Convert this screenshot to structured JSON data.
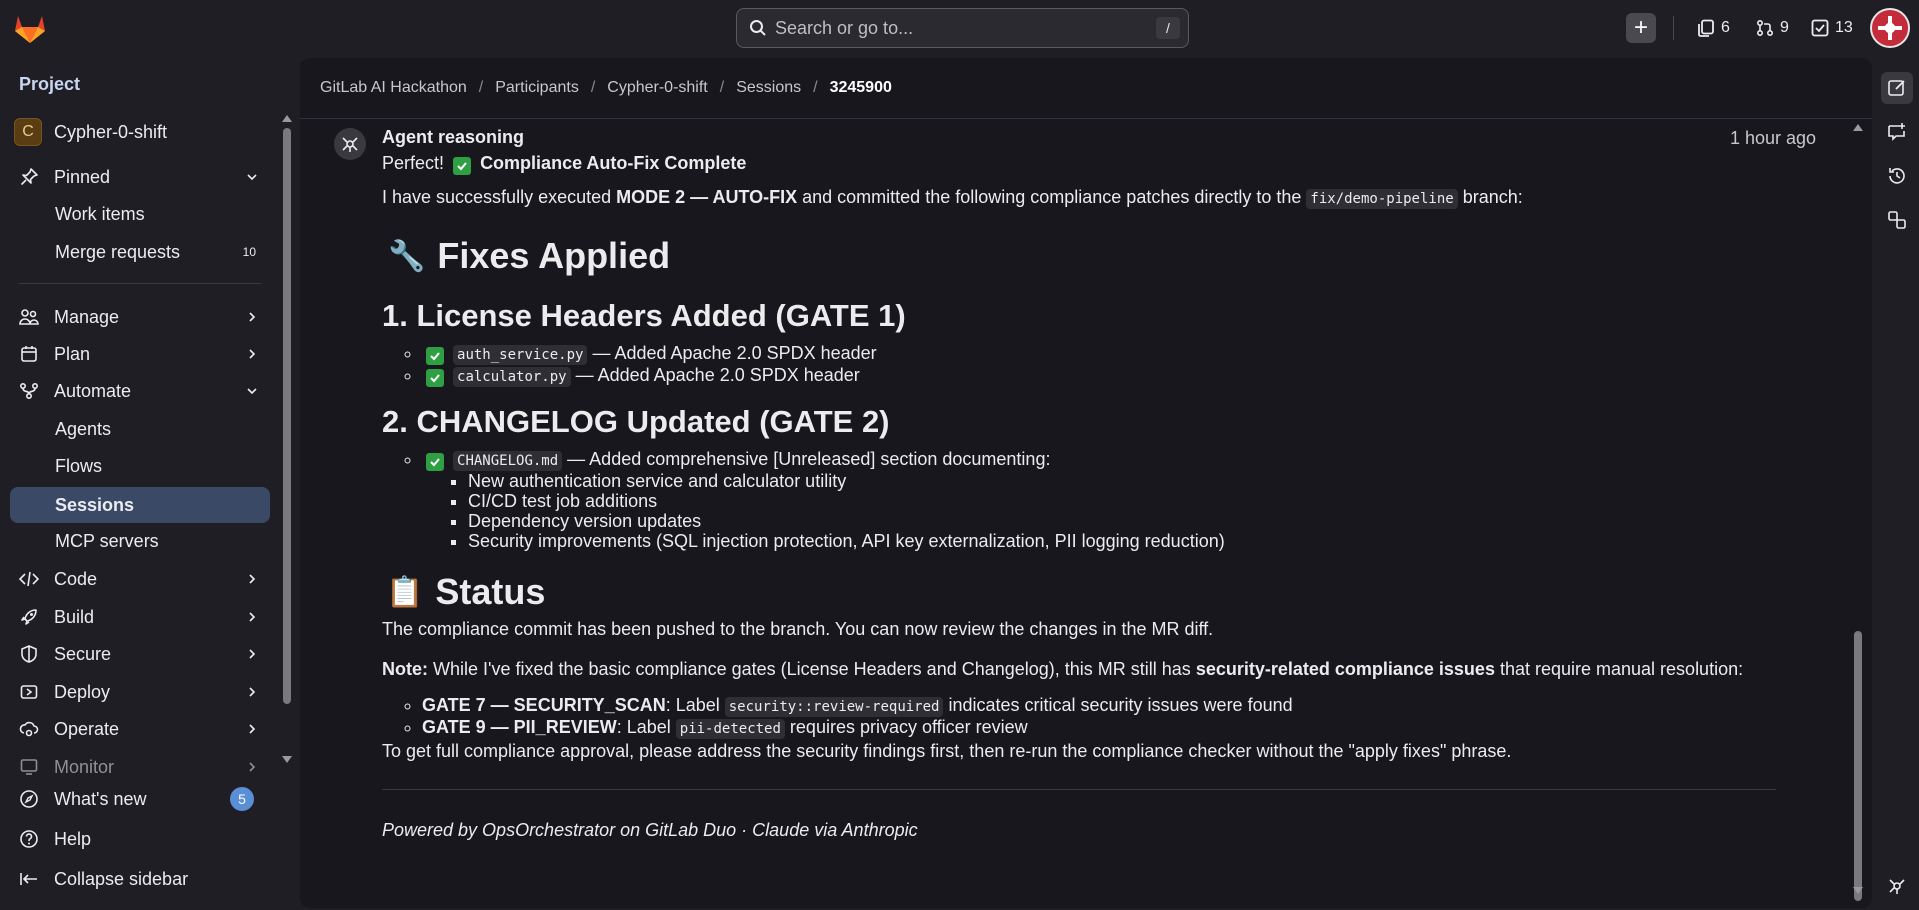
{
  "topbar": {
    "search_placeholder": "Search or go to...",
    "search_shortcut": "/",
    "issues_count": "6",
    "merge_requests_count": "9",
    "todos_count": "13"
  },
  "sidebar": {
    "heading": "Project",
    "project_initial": "C",
    "project_name": "Cypher-0-shift",
    "pinned": "Pinned",
    "work_items": "Work items",
    "merge_requests": "Merge requests",
    "merge_requests_count": "10",
    "manage": "Manage",
    "plan": "Plan",
    "automate": "Automate",
    "agents": "Agents",
    "flows": "Flows",
    "sessions": "Sessions",
    "mcp_servers": "MCP servers",
    "code": "Code",
    "build": "Build",
    "secure": "Secure",
    "deploy": "Deploy",
    "operate": "Operate",
    "monitor": "Monitor",
    "whats_new": "What's new",
    "whats_new_count": "5",
    "help": "Help",
    "collapse": "Collapse sidebar"
  },
  "breadcrumb": {
    "items": [
      "GitLab AI Hackathon",
      "Participants",
      "Cypher-0-shift",
      "Sessions"
    ],
    "current": "3245900"
  },
  "message": {
    "author": "Agent reasoning",
    "time": "1 hour ago",
    "perfect": "Perfect!",
    "complete_title": "Compliance Auto-Fix Complete",
    "intro_1": "I have successfully executed ",
    "intro_mode": "MODE 2 — AUTO-FIX",
    "intro_2": " and committed the following compliance patches directly to the ",
    "intro_branch": "fix/demo-pipeline",
    "intro_3": " branch:",
    "fixes_heading": "Fixes Applied",
    "fixes_emoji": "🔧",
    "license_heading": "1. License Headers Added (GATE 1)",
    "license_items": [
      {
        "file": "auth_service.py",
        "text": " — Added Apache 2.0 SPDX header"
      },
      {
        "file": "calculator.py",
        "text": " — Added Apache 2.0 SPDX header"
      }
    ],
    "changelog_heading": "2. CHANGELOG Updated (GATE 2)",
    "changelog_file": "CHANGELOG.md",
    "changelog_text": " — Added comprehensive [Unreleased] section documenting:",
    "changelog_items": [
      "New authentication service and calculator utility",
      "CI/CD test job additions",
      "Dependency version updates",
      "Security improvements (SQL injection protection, API key externalization, PII logging reduction)"
    ],
    "status_heading": "Status",
    "status_emoji": "📋",
    "status_text": "The compliance commit has been pushed to the branch. You can now review the changes in the MR diff.",
    "note_label": "Note:",
    "note_1": " While I've fixed the basic compliance gates (License Headers and Changelog), this MR still has ",
    "note_bold": "security-related compliance issues",
    "note_2": " that require manual resolution:",
    "gates": [
      {
        "name": "GATE 7 — SECURITY_SCAN",
        "pre": ": Label ",
        "label": "security::review-required",
        "post": " indicates critical security issues were found"
      },
      {
        "name": "GATE 9 — PII_REVIEW",
        "pre": ": Label ",
        "label": "pii-detected",
        "post": " requires privacy officer review"
      }
    ],
    "closing": "To get full compliance approval, please address the security findings first, then re-run the compliance checker without the \"apply fixes\" phrase.",
    "footer": "Powered by OpsOrchestrator on GitLab Duo · Claude via Anthropic"
  },
  "icons": {
    "logo": "gitlab-tanuki-logo",
    "search": "search-icon",
    "new": "plus-icon",
    "issues": "issues-icon",
    "merge_requests": "merge-request-icon",
    "todos": "todo-icon",
    "agent": "duo-agent-icon",
    "rail": [
      "edit-icon",
      "new-comment-icon",
      "history-icon",
      "switch-icon",
      "duo-icon"
    ]
  },
  "colors": {
    "background": "#1f1e24",
    "panel": "#18171d",
    "active_nav": "#3a4a66",
    "check": "#2ea043",
    "badge": "#5a8fd6"
  }
}
